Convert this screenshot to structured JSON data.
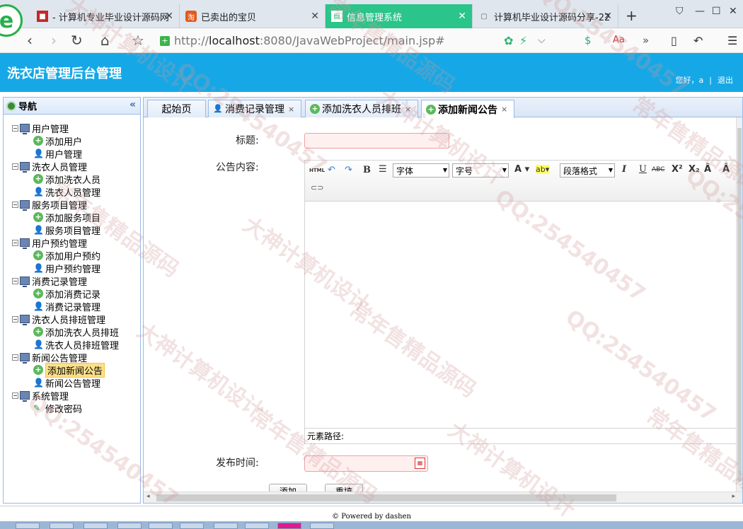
{
  "browser": {
    "tabs": [
      {
        "label": "- 计算机专业毕业设计源码网",
        "active": false
      },
      {
        "label": "已卖出的宝贝",
        "active": false
      },
      {
        "label": "信息管理系统",
        "active": true
      },
      {
        "label": "计算机毕业设计源码分享-22",
        "active": false
      }
    ],
    "new_tab": "+",
    "url_prefix": "http://",
    "url_host": "localhost",
    "url_path": ":8080/JavaWebProject/main.jsp#"
  },
  "header": {
    "title": "洗衣店管理后台管理",
    "greeting": "您好，a",
    "separator": "|",
    "logout": "退出"
  },
  "sidebar": {
    "title": "导航",
    "collapse": "«",
    "groups": [
      {
        "label": "用户管理",
        "items": [
          {
            "label": "添加用户",
            "type": "add"
          },
          {
            "label": "用户管理",
            "type": "user"
          }
        ]
      },
      {
        "label": "洗衣人员管理",
        "items": [
          {
            "label": "添加洗衣人员",
            "type": "add"
          },
          {
            "label": "洗衣人员管理",
            "type": "user"
          }
        ]
      },
      {
        "label": "服务项目管理",
        "items": [
          {
            "label": "添加服务项目",
            "type": "add"
          },
          {
            "label": "服务项目管理",
            "type": "user"
          }
        ]
      },
      {
        "label": "用户预约管理",
        "items": [
          {
            "label": "添加用户预约",
            "type": "add"
          },
          {
            "label": "用户预约管理",
            "type": "user"
          }
        ]
      },
      {
        "label": "消费记录管理",
        "items": [
          {
            "label": "添加消费记录",
            "type": "add"
          },
          {
            "label": "消费记录管理",
            "type": "user"
          }
        ]
      },
      {
        "label": "洗衣人员排班管理",
        "items": [
          {
            "label": "添加洗衣人员排班",
            "type": "add"
          },
          {
            "label": "洗衣人员排班管理",
            "type": "user"
          }
        ]
      },
      {
        "label": "新闻公告管理",
        "items": [
          {
            "label": "添加新闻公告",
            "type": "add",
            "selected": true
          },
          {
            "label": "新闻公告管理",
            "type": "user"
          }
        ]
      },
      {
        "label": "系统管理",
        "items": [
          {
            "label": "修改密码",
            "type": "pen"
          }
        ]
      }
    ]
  },
  "content_tabs": [
    {
      "label": "起始页",
      "icon": "",
      "closable": false
    },
    {
      "label": "消费记录管理",
      "icon": "user",
      "closable": true
    },
    {
      "label": "添加洗衣人员排班",
      "icon": "add",
      "closable": true
    },
    {
      "label": "添加新闻公告",
      "icon": "add",
      "closable": true,
      "active": true
    }
  ],
  "form": {
    "title_label": "标题:",
    "content_label": "公告内容:",
    "publish_time_label": "发布时间:",
    "path_label": "元素路径:",
    "font_select": "字体",
    "size_select": "字号",
    "paragraph_select": "段落格式",
    "submit_button": "添加",
    "reset_button": "重填"
  },
  "footer": {
    "text": "© Powered by dashen"
  },
  "watermarks": [
    "QQ:254540457",
    "大神计算机设计",
    "常年售精品源码"
  ],
  "colors": {
    "header": "#16a8e6",
    "active_browser_tab": "#2bc48b",
    "selected_node": "#fbe08a"
  }
}
